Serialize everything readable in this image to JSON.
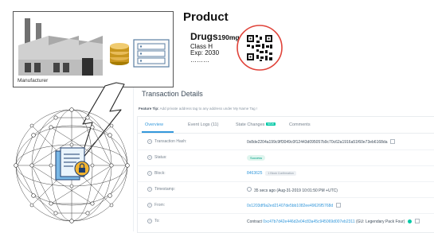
{
  "manufacturer": {
    "label": "Manufacturer"
  },
  "product": {
    "title": "Product",
    "drug_name": "Drugs",
    "drug_dose": "190mg",
    "class": "Class H",
    "exp": "Exp: 2030",
    "dots": "………"
  },
  "transaction": {
    "title": "Transaction Details",
    "tip_label": "Feature Tip:",
    "tip_text": " Add private address tag to any address under My Name Tag !",
    "tabs": [
      {
        "label": "Overview"
      },
      {
        "label": "Event Logs (11)"
      },
      {
        "label": "State Changes"
      },
      {
        "label": "Comments"
      }
    ],
    "new_badge": "NEW",
    "rows": {
      "hash": {
        "label": "Transaction Hash:",
        "value": "0x8de2204a199c9ff3049c0f12443d095057b9c70c62a1916a51f60e73eb6168da"
      },
      "status": {
        "label": "Status:",
        "value": "Success"
      },
      "block": {
        "label": "Block:",
        "value": "8463625",
        "confirm": "1 Block Confirmation"
      },
      "timestamp": {
        "label": "Timestamp:",
        "value": "35 secs ago (Aug-31-2019 10:01:50 PM +UTC)"
      },
      "from": {
        "label": "From:",
        "value": "0x1203df9a2ed21407de5bb1082ee49626f5768d"
      },
      "to": {
        "label": "To:",
        "prefix": "Contract ",
        "value": "0xc47b7d42e446d2e04c83a45c945069d007eb2311",
        "suffix": " (GU: Legendary Pack Four)"
      }
    }
  }
}
